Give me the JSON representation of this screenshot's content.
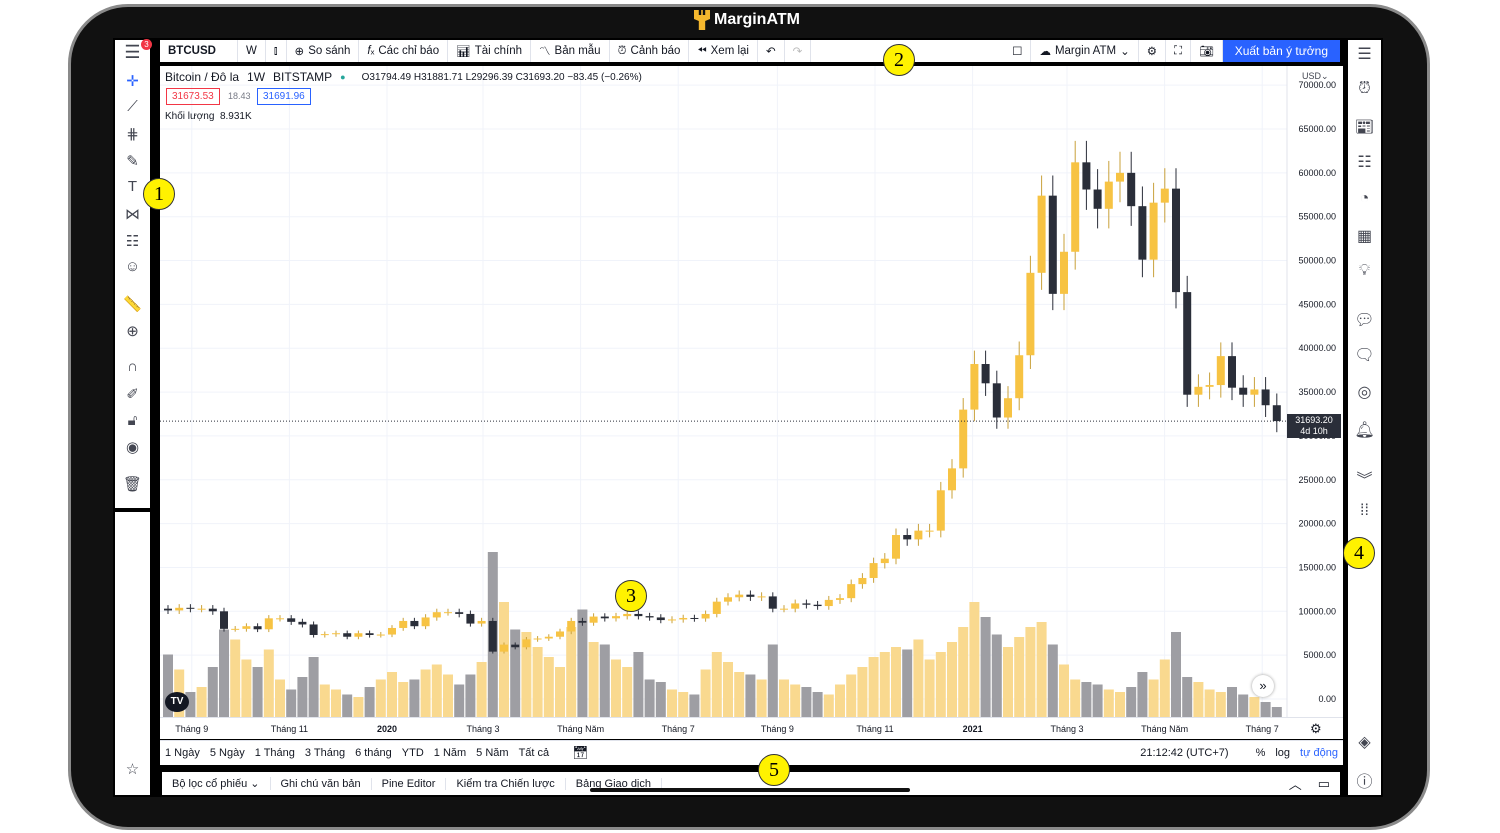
{
  "app": {
    "brand": "MarginATM",
    "notification_count": "3"
  },
  "toolbar": {
    "symbol": "BTCUSD",
    "interval": "W",
    "compare": "So sánh",
    "indicators": "Các chỉ báo",
    "financials": "Tài chính",
    "templates": "Bản mẫu",
    "alert": "Cảnh báo",
    "replay": "Xem lại",
    "layout_name": "Margin ATM",
    "publish": "Xuất bản ý tưởng"
  },
  "legend": {
    "title": "Bitcoin / Đô la",
    "interval": "1W",
    "exchange": "BITSTAMP",
    "ohlc": "O31794.49 H31881.71 L29296.39 C31693.20 −83.45 (−0.26%)",
    "bid": "31673.53",
    "spread": "18.43",
    "ask": "31691.96",
    "volume_label": "Khối lượng",
    "volume_value": "8.931K"
  },
  "price_axis": {
    "currency": "USD",
    "last_price": "31693.20",
    "countdown": "4d 10h"
  },
  "range_bar": {
    "items": [
      "1 Ngày",
      "5 Ngày",
      "1 Tháng",
      "3 Tháng",
      "6 tháng",
      "YTD",
      "1 Năm",
      "5 Năm",
      "Tất cả"
    ],
    "clock": "21:12:42 (UTC+7)",
    "percent": "%",
    "log": "log",
    "auto": "tự động"
  },
  "bottom_tabs": [
    "Bộ lọc cổ phiếu",
    "Ghi chú văn bản",
    "Pine Editor",
    "Kiểm tra Chiến lược",
    "Bảng Giao dịch"
  ],
  "annotations": [
    "1",
    "2",
    "3",
    "4",
    "5"
  ],
  "colors": {
    "up": "#f7c343",
    "down": "#2a2e39",
    "vol_up": "#f9d98f",
    "vol_down": "#9e9ea3",
    "accent": "#2962ff"
  },
  "chart_data": {
    "type": "candlestick",
    "interval": "1W",
    "ylim": [
      0,
      70000
    ],
    "yticks": [
      0,
      5000,
      10000,
      15000,
      20000,
      25000,
      30000,
      35000,
      40000,
      45000,
      50000,
      55000,
      60000,
      65000,
      70000
    ],
    "ytick_labels": [
      "0.00",
      "5000.00",
      "10000.00",
      "15000.00",
      "20000.00",
      "25000.00",
      "30000.00",
      "35000.00",
      "40000.00",
      "45000.00",
      "50000.00",
      "55000.00",
      "60000.00",
      "65000.00",
      "70000.00"
    ],
    "xticks": [
      {
        "label": "Tháng 9",
        "date": "2019-09"
      },
      {
        "label": "Tháng 11",
        "date": "2019-11"
      },
      {
        "label": "2020",
        "date": "2020-01"
      },
      {
        "label": "Tháng 3",
        "date": "2020-03"
      },
      {
        "label": "Tháng Năm",
        "date": "2020-05"
      },
      {
        "label": "Tháng 7",
        "date": "2020-07"
      },
      {
        "label": "Tháng 9",
        "date": "2020-09"
      },
      {
        "label": "Tháng 11",
        "date": "2020-11"
      },
      {
        "label": "2021",
        "date": "2021-01"
      },
      {
        "label": "Tháng 3",
        "date": "2021-03"
      },
      {
        "label": "Tháng Năm",
        "date": "2021-05"
      },
      {
        "label": "Tháng 7",
        "date": "2021-07"
      }
    ],
    "first_open": 10300,
    "close": [
      10100,
      10400,
      10300,
      10300,
      10000,
      8000,
      8000,
      8300,
      7950,
      9200,
      9200,
      8800,
      8500,
      7300,
      7400,
      7500,
      7100,
      7500,
      7300,
      7350,
      8100,
      8900,
      8300,
      9300,
      9900,
      9900,
      9700,
      8600,
      8900,
      5400,
      6200,
      5900,
      6800,
      6900,
      7100,
      7700,
      8900,
      8700,
      9400,
      9200,
      9450,
      9700,
      9450,
      9300,
      9000,
      9070,
      9240,
      9180,
      9700,
      11100,
      11600,
      11900,
      11650,
      11700,
      10300,
      10300,
      10900,
      10750,
      10600,
      11300,
      11500,
      13100,
      13800,
      15500,
      16000,
      18700,
      18200,
      19200,
      19200,
      23800,
      26300,
      33000,
      38200,
      36000,
      32100,
      34300,
      39200,
      48600,
      57400,
      46200,
      51000,
      61200,
      58100,
      55900,
      59000,
      60000,
      56200,
      50100,
      56600,
      58200,
      46400,
      34700,
      35600,
      35800,
      39100,
      35500,
      34700,
      35300,
      33500,
      31693
    ],
    "volume_k": [
      50,
      38,
      20,
      24,
      40,
      70,
      62,
      46,
      40,
      54,
      30,
      22,
      32,
      48,
      26,
      22,
      18,
      16,
      24,
      30,
      36,
      28,
      30,
      38,
      42,
      34,
      26,
      34,
      44,
      132,
      92,
      70,
      68,
      56,
      48,
      40,
      72,
      86,
      60,
      58,
      46,
      40,
      52,
      30,
      28,
      22,
      20,
      18,
      38,
      52,
      44,
      36,
      34,
      30,
      58,
      30,
      26,
      24,
      20,
      18,
      26,
      34,
      40,
      48,
      52,
      56,
      54,
      62,
      46,
      52,
      60,
      72,
      92,
      80,
      66,
      56,
      64,
      72,
      76,
      58,
      42,
      30,
      28,
      26,
      22,
      20,
      24,
      36,
      30,
      46,
      68,
      32,
      28,
      22,
      20,
      24,
      18,
      16,
      12,
      8
    ]
  }
}
